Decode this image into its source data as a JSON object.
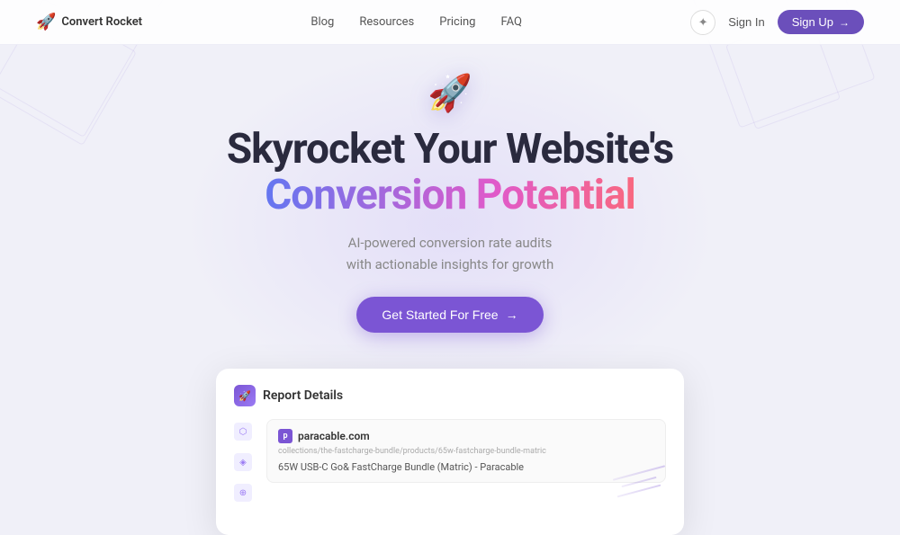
{
  "app": {
    "name": "Convert Rocket"
  },
  "navbar": {
    "logo_text": "Convert Rocket",
    "nav_items": [
      {
        "label": "Blog",
        "id": "blog"
      },
      {
        "label": "Resources",
        "id": "resources"
      },
      {
        "label": "Pricing",
        "id": "pricing"
      },
      {
        "label": "FAQ",
        "id": "faq"
      }
    ],
    "sign_in_label": "Sign In",
    "sign_up_label": "Sign Up",
    "sign_up_arrow": "→"
  },
  "hero": {
    "title_line1": "Skyrocket Your Website's",
    "title_line2": "Conversion Potential",
    "subtitle_line1": "AI-powered conversion rate audits",
    "subtitle_line2": "with actionable insights for growth",
    "cta_label": "Get Started For Free",
    "cta_arrow": "→"
  },
  "dashboard": {
    "report_title": "Report Details",
    "url_domain": "paracable.com",
    "url_path": "collections/the-fastcharge-bundle/products/65w-fastcharge-bundle-matric",
    "url_display": "collections/the-fastcharge-bundle/products/65w-fastcharge-bundle-matric",
    "product_title": "65W USB-C Go& FastCharge Bundle (Matric) - Paracable"
  },
  "icons": {
    "rocket": "🚀",
    "sun": "☀",
    "arrow_right": "→"
  }
}
